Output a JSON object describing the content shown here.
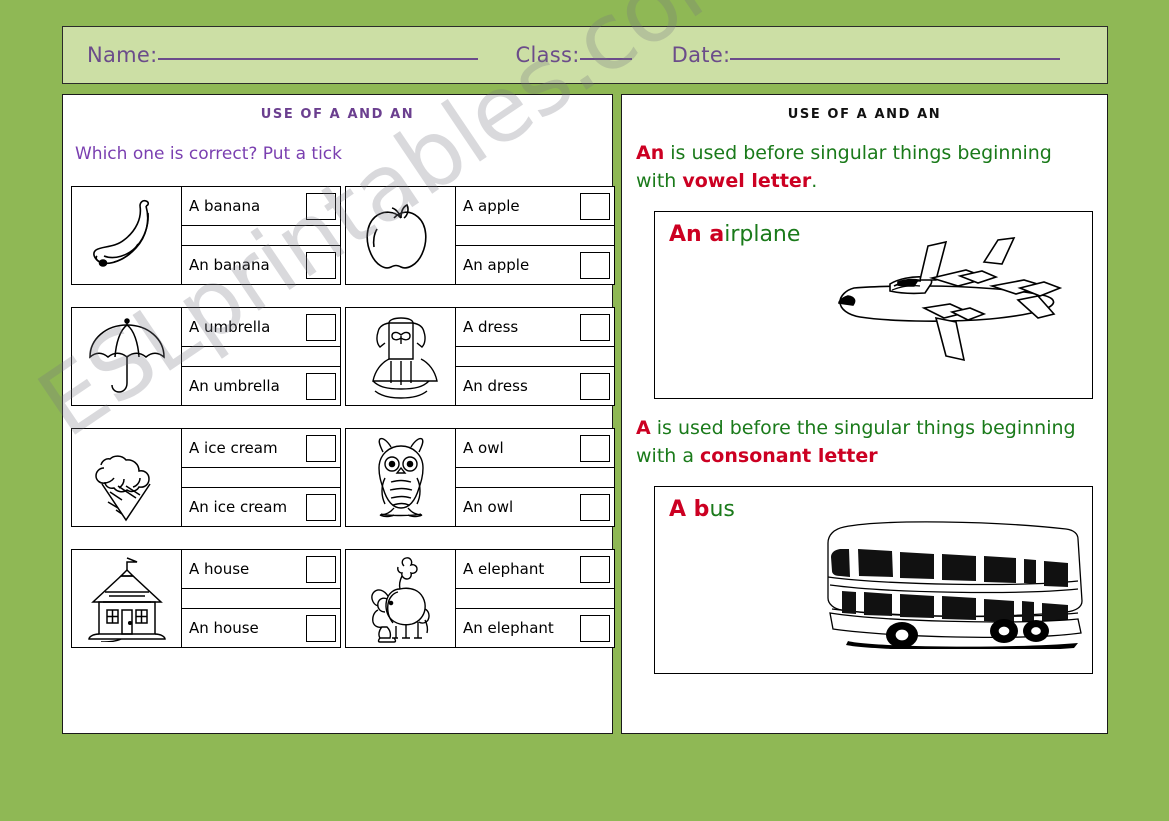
{
  "page": {
    "background_color": "#8fb855",
    "watermark": "ESLprintables.com"
  },
  "header": {
    "name_label": "Name:",
    "class_label": "Class:",
    "date_label": "Date:",
    "name_value": "",
    "class_value": "",
    "date_value": "",
    "text_color": "#6b4c8a",
    "background_color": "#ccdfa5"
  },
  "left_panel": {
    "title": "USE OF A AND AN",
    "title_color": "#6b3f8f",
    "instruction": "Which one is correct? Put a tick",
    "instruction_color": "#7a3fb0",
    "items": [
      {
        "icon": "banana-icon",
        "option_a": "A banana",
        "option_b": "An banana"
      },
      {
        "icon": "apple-icon",
        "option_a": "A apple",
        "option_b": "An apple"
      },
      {
        "icon": "umbrella-icon",
        "option_a": "A umbrella",
        "option_b": "An umbrella"
      },
      {
        "icon": "dress-icon",
        "option_a": "A dress",
        "option_b": "An dress"
      },
      {
        "icon": "icecream-icon",
        "option_a": "A ice cream",
        "option_b": "An ice cream"
      },
      {
        "icon": "owl-icon",
        "option_a": "A owl",
        "option_b": "An owl"
      },
      {
        "icon": "house-icon",
        "option_a": "A house",
        "option_b": "An house"
      },
      {
        "icon": "elephant-icon",
        "option_a": "A elephant",
        "option_b": "An elephant"
      }
    ]
  },
  "right_panel": {
    "title": "USE OF A AND AN",
    "title_color": "#111111",
    "rule_an": {
      "highlight_start": "An",
      "middle": " is used before singular things beginning with ",
      "highlight_end": "vowel letter",
      "tail": "."
    },
    "rule_a": {
      "highlight_start": "A",
      "middle": " is used before the singular things beginning with a ",
      "highlight_end": "consonant letter",
      "tail": ""
    },
    "example_airplane": {
      "red_part": "An a",
      "green_part": "irplane",
      "icon": "airplane-icon"
    },
    "example_bus": {
      "red_part": "A b",
      "green_part": "us",
      "icon": "bus-icon"
    },
    "green_color": "#1a7a1a",
    "red_color": "#cc0022"
  }
}
